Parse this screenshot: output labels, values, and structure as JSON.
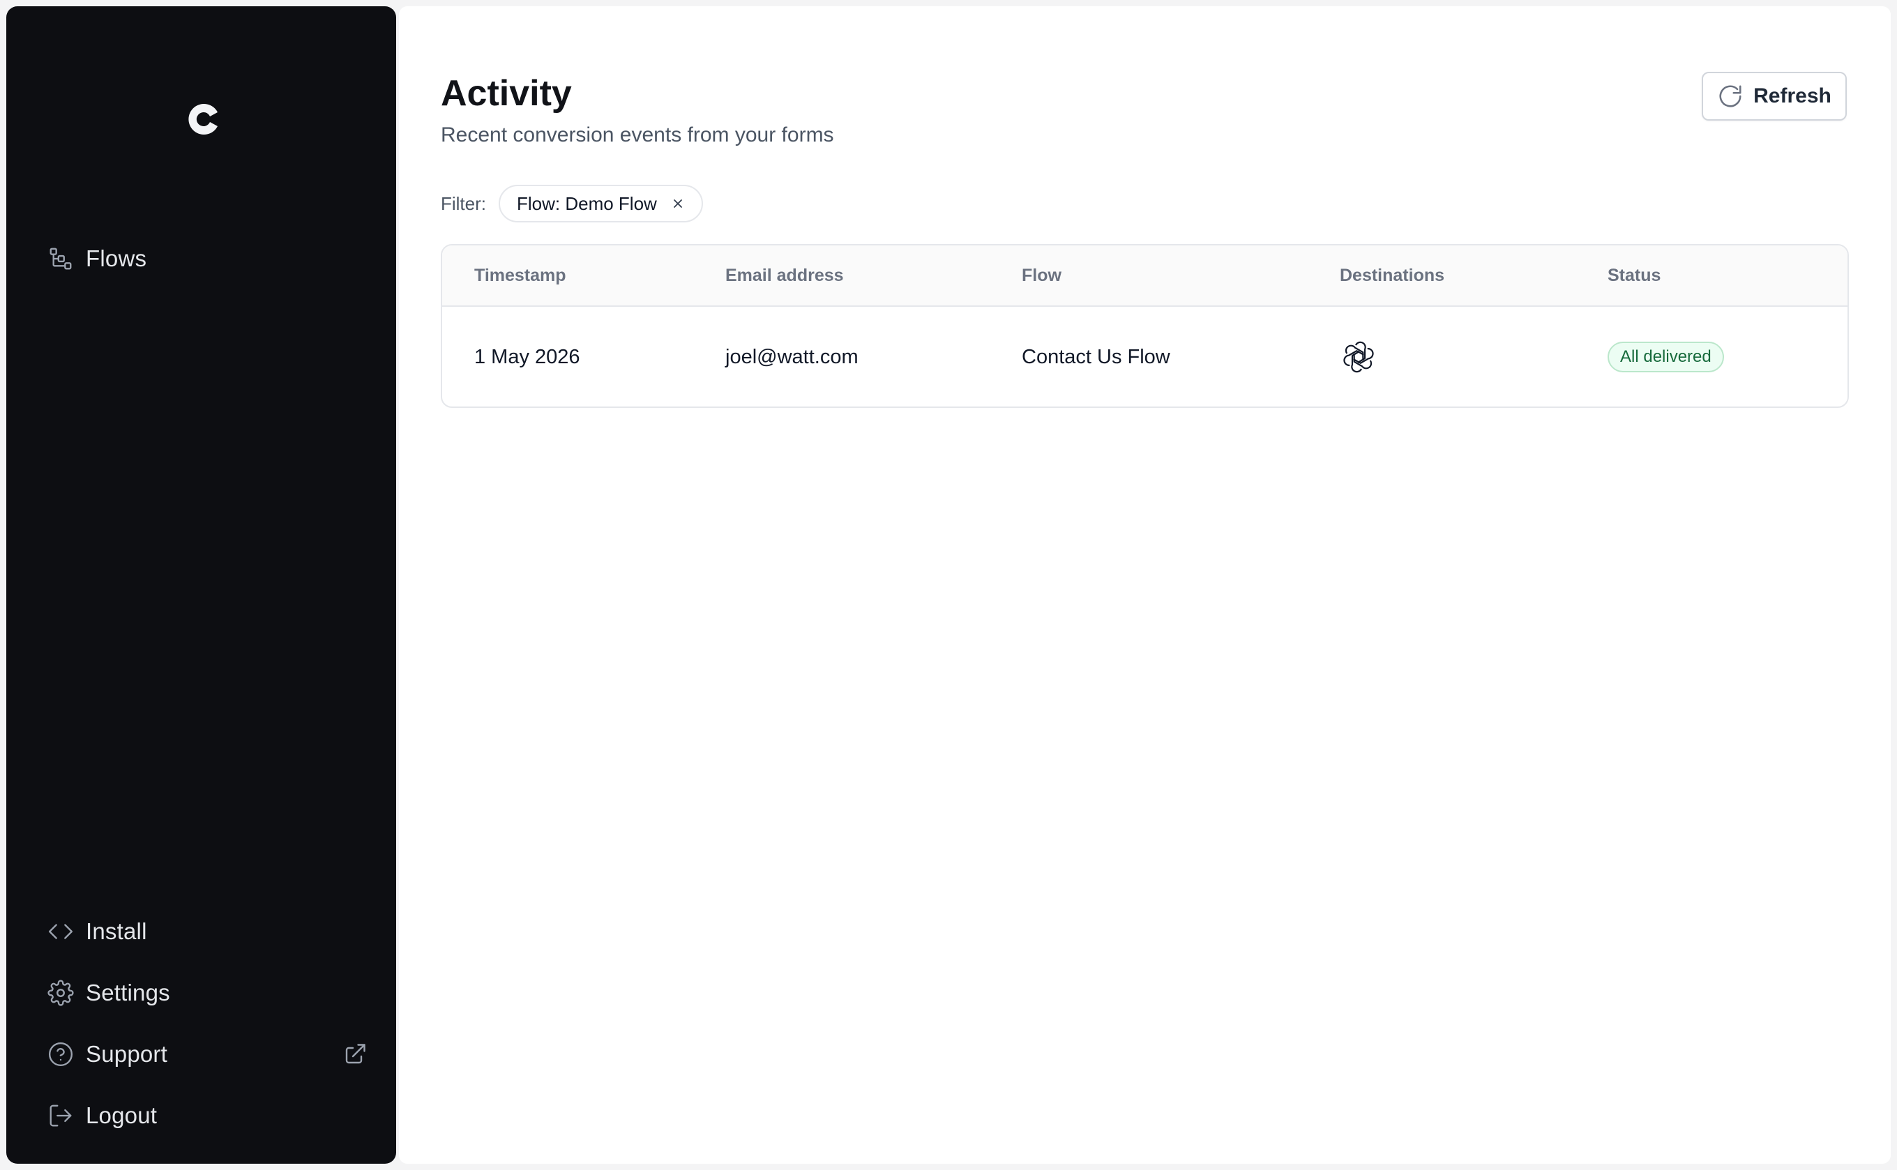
{
  "sidebar": {
    "logo_icon": "brand-c-logo",
    "top_items": [
      {
        "label": "Flows",
        "icon": "flows-icon"
      }
    ],
    "bottom_items": [
      {
        "label": "Install",
        "icon": "code-icon"
      },
      {
        "label": "Settings",
        "icon": "gear-icon"
      },
      {
        "label": "Support",
        "icon": "help-circle-icon",
        "external": true
      },
      {
        "label": "Logout",
        "icon": "logout-icon"
      }
    ]
  },
  "header": {
    "title": "Activity",
    "subtitle": "Recent conversion events from your forms",
    "refresh_label": "Refresh"
  },
  "filter": {
    "label": "Filter:",
    "chip_label": "Flow: Demo Flow"
  },
  "table": {
    "columns": [
      "Timestamp",
      "Email address",
      "Flow",
      "Destinations",
      "Status"
    ],
    "rows": [
      {
        "timestamp": "1 May 2026",
        "email": "joel@watt.com",
        "flow": "Contact Us Flow",
        "destinations": [
          "openai-icon"
        ],
        "status": "All delivered"
      }
    ]
  },
  "colors": {
    "sidebar_bg": "#0d0e12",
    "status_success_text": "#166a3b",
    "status_success_bg": "#ecfdf3"
  }
}
